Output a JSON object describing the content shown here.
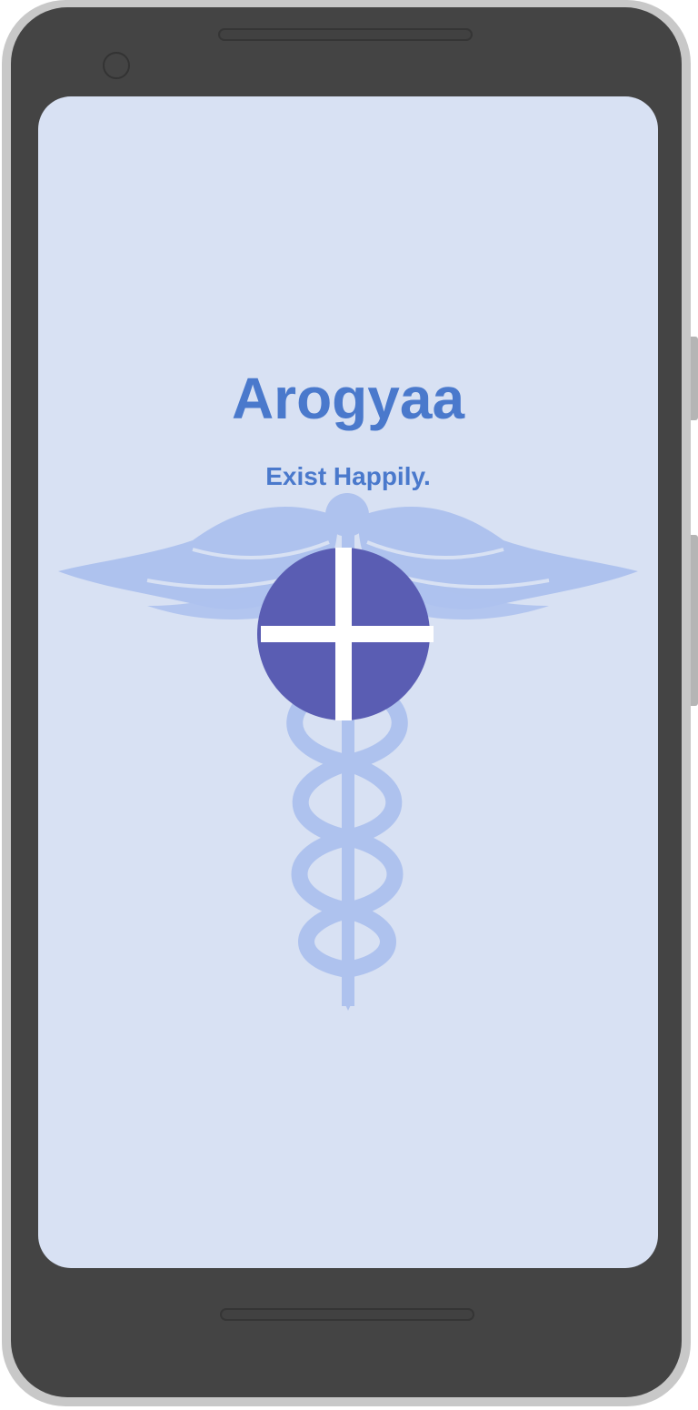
{
  "app": {
    "title": "Arogyaa",
    "tagline": "Exist Happily."
  },
  "icons": {
    "background": "caduceus-icon",
    "center": "medical-cross-icon"
  },
  "colors": {
    "screen_background": "#d8e1f3",
    "title_color": "#4a79cc",
    "emblem_color": "#aec2ee",
    "cross_circle": "#5a5db3",
    "cross_bars": "#ffffff",
    "device_frame": "#444444"
  }
}
